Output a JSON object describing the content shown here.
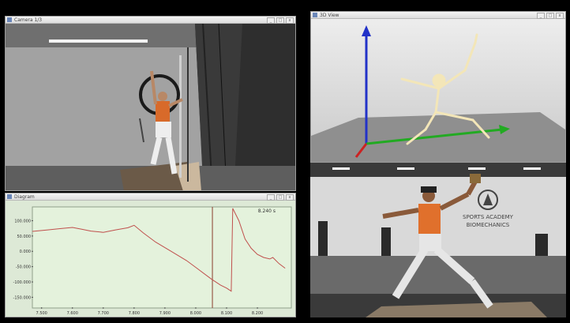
{
  "camera_window": {
    "title": "Camera 1/3"
  },
  "model_window": {
    "title": "3D View"
  },
  "diagram_window": {
    "title": "Diagram",
    "readout": "8.240 s"
  },
  "video_sign": {
    "line1": "SPORTS ACADEMY",
    "line2": "BIOMECHANICS"
  },
  "window_buttons": {
    "minimize": "_",
    "maximize": "□",
    "close": "x"
  },
  "chart_data": {
    "type": "line",
    "y_ticks": [
      "100.000",
      "50.000",
      "0.000",
      "-50.000",
      "-100.000",
      "-150.000"
    ],
    "x_ticks": [
      "7.500",
      "7.600",
      "7.700",
      "7.800",
      "7.900",
      "8.000",
      "8.100",
      "8.200"
    ],
    "ylim": [
      -185,
      145
    ],
    "xlim": [
      7.47,
      8.31
    ],
    "cursor_x": 8.054,
    "series": [
      {
        "color": "#c0504d",
        "x": [
          7.47,
          7.52,
          7.56,
          7.6,
          7.63,
          7.66,
          7.7,
          7.74,
          7.78,
          7.8,
          7.83,
          7.87,
          7.92,
          7.97,
          8.01,
          8.05,
          8.08,
          8.1,
          8.115,
          8.12,
          8.14,
          8.16,
          8.18,
          8.2,
          8.22,
          8.24,
          8.25,
          8.27,
          8.29
        ],
        "y": [
          65,
          70,
          74,
          78,
          72,
          66,
          62,
          70,
          77,
          85,
          60,
          30,
          0,
          -30,
          -60,
          -90,
          -110,
          -120,
          -130,
          140,
          100,
          40,
          10,
          -10,
          -20,
          -25,
          -20,
          -40,
          -55
        ]
      }
    ]
  }
}
